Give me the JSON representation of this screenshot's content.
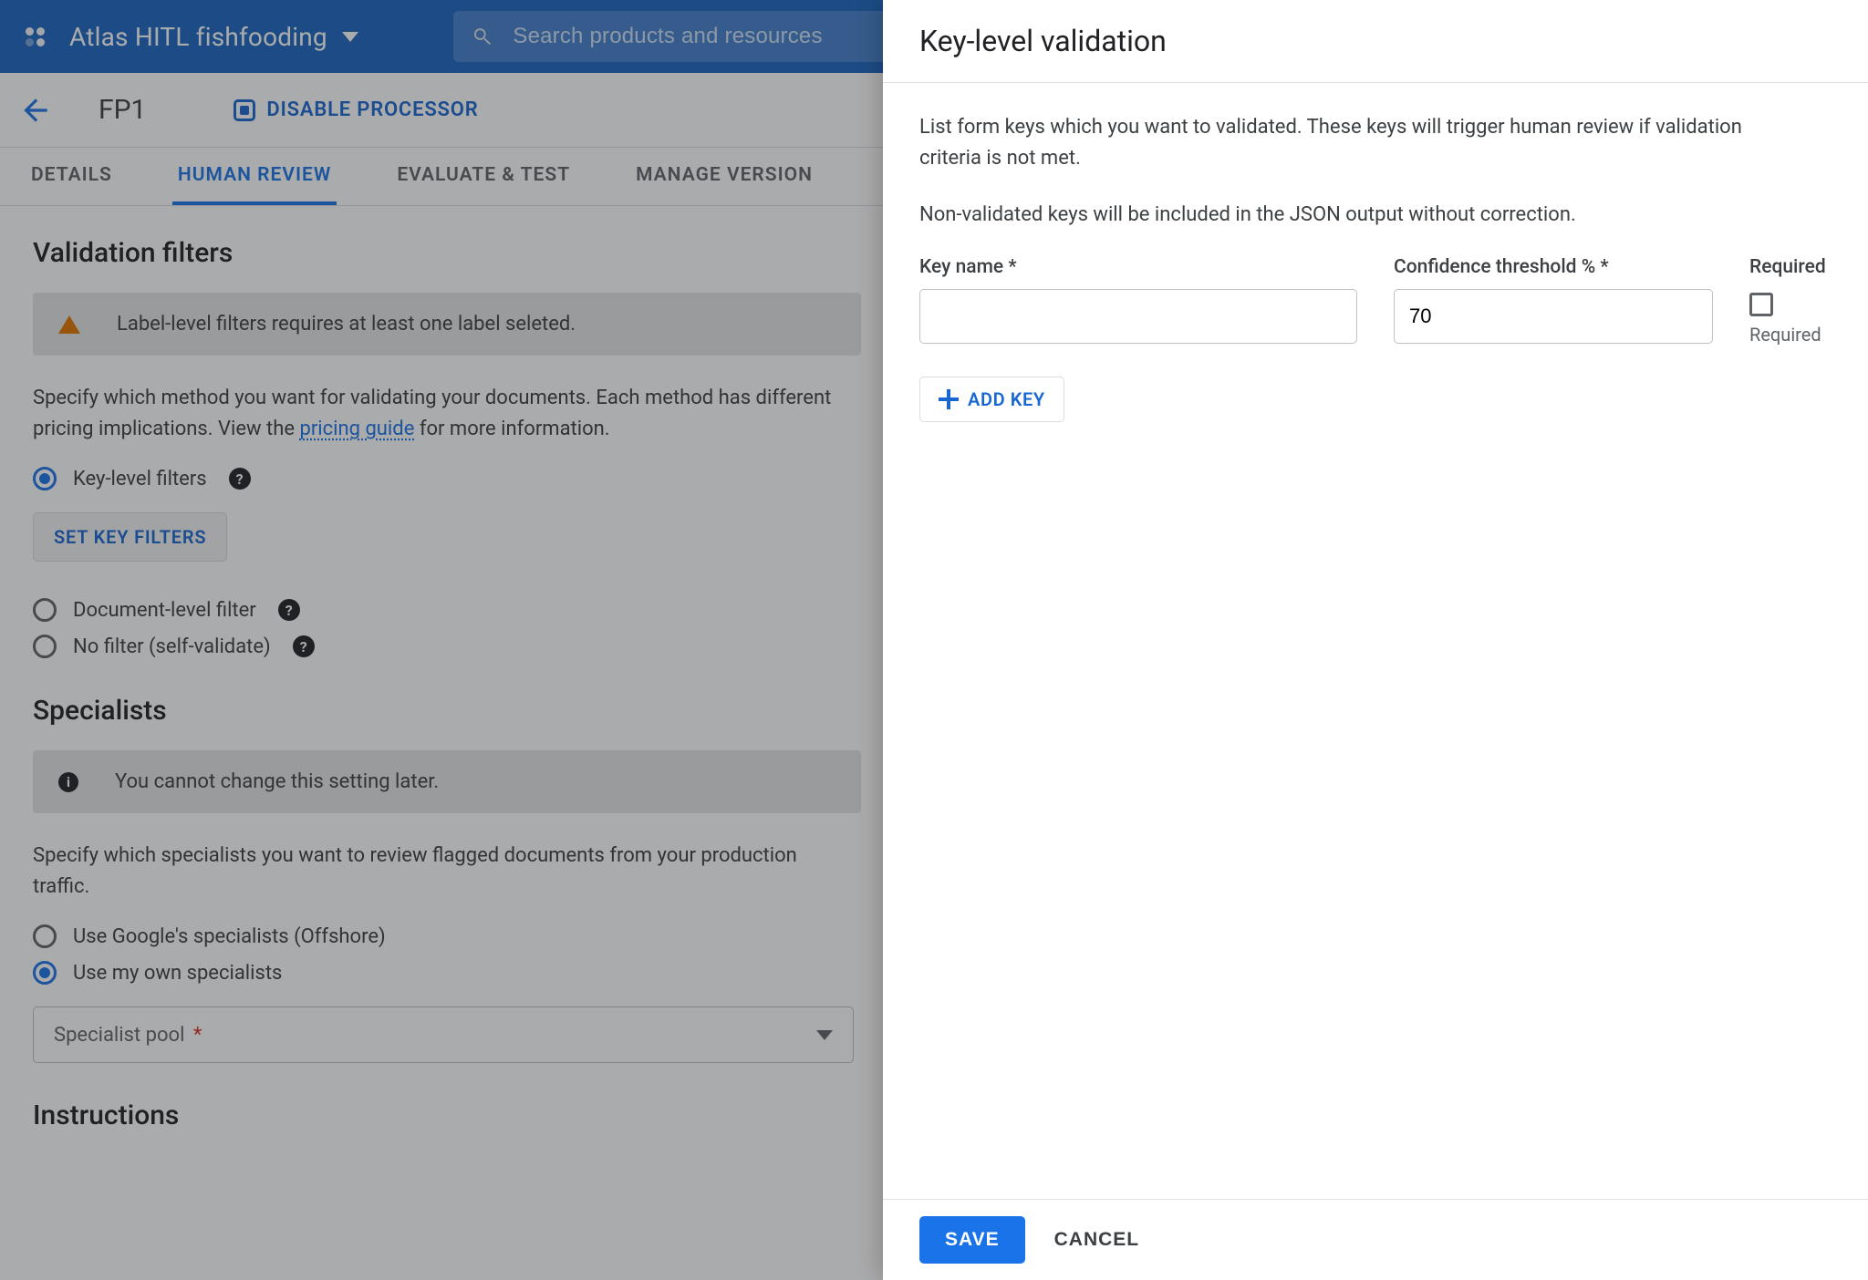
{
  "topbar": {
    "project_name": "Atlas HITL fishfooding",
    "search_placeholder": "Search products and resources"
  },
  "secondbar": {
    "processor_title": "FP1",
    "disable_label": "DISABLE PROCESSOR"
  },
  "tabs": [
    {
      "label": "DETAILS"
    },
    {
      "label": "HUMAN REVIEW"
    },
    {
      "label": "EVALUATE & TEST"
    },
    {
      "label": "MANAGE VERSION"
    }
  ],
  "validation": {
    "heading": "Validation filters",
    "warning": "Label-level filters requires at least one label seleted.",
    "desc_prefix": "Specify which method you want for validating your documents. Each method has different pricing implications. View the ",
    "desc_link": "pricing guide",
    "desc_suffix": " for more information.",
    "options": {
      "key": "Key-level filters",
      "doc": "Document-level filter",
      "none": "No filter (self-validate)"
    },
    "set_key_filters_btn": "SET KEY FILTERS"
  },
  "specialists": {
    "heading": "Specialists",
    "info": "You cannot change this setting later.",
    "desc": "Specify which specialists you want to review flagged documents from your production traffic.",
    "options": {
      "google": "Use Google's specialists (Offshore)",
      "own": "Use my own specialists"
    },
    "pool_label": "Specialist pool"
  },
  "instructions_heading_truncated": "Instructions",
  "panel": {
    "title": "Key-level validation",
    "p1": "List form keys which you want to validated. These keys will trigger human review if validation criteria is not met.",
    "p2": "Non-validated keys will be included in the JSON output without correction.",
    "key_label": "Key name *",
    "threshold_label": "Confidence threshold % *",
    "required_header": "Required",
    "threshold_value": "70",
    "required_caption": "Required",
    "add_key": "ADD KEY",
    "save": "SAVE",
    "cancel": "CANCEL"
  }
}
